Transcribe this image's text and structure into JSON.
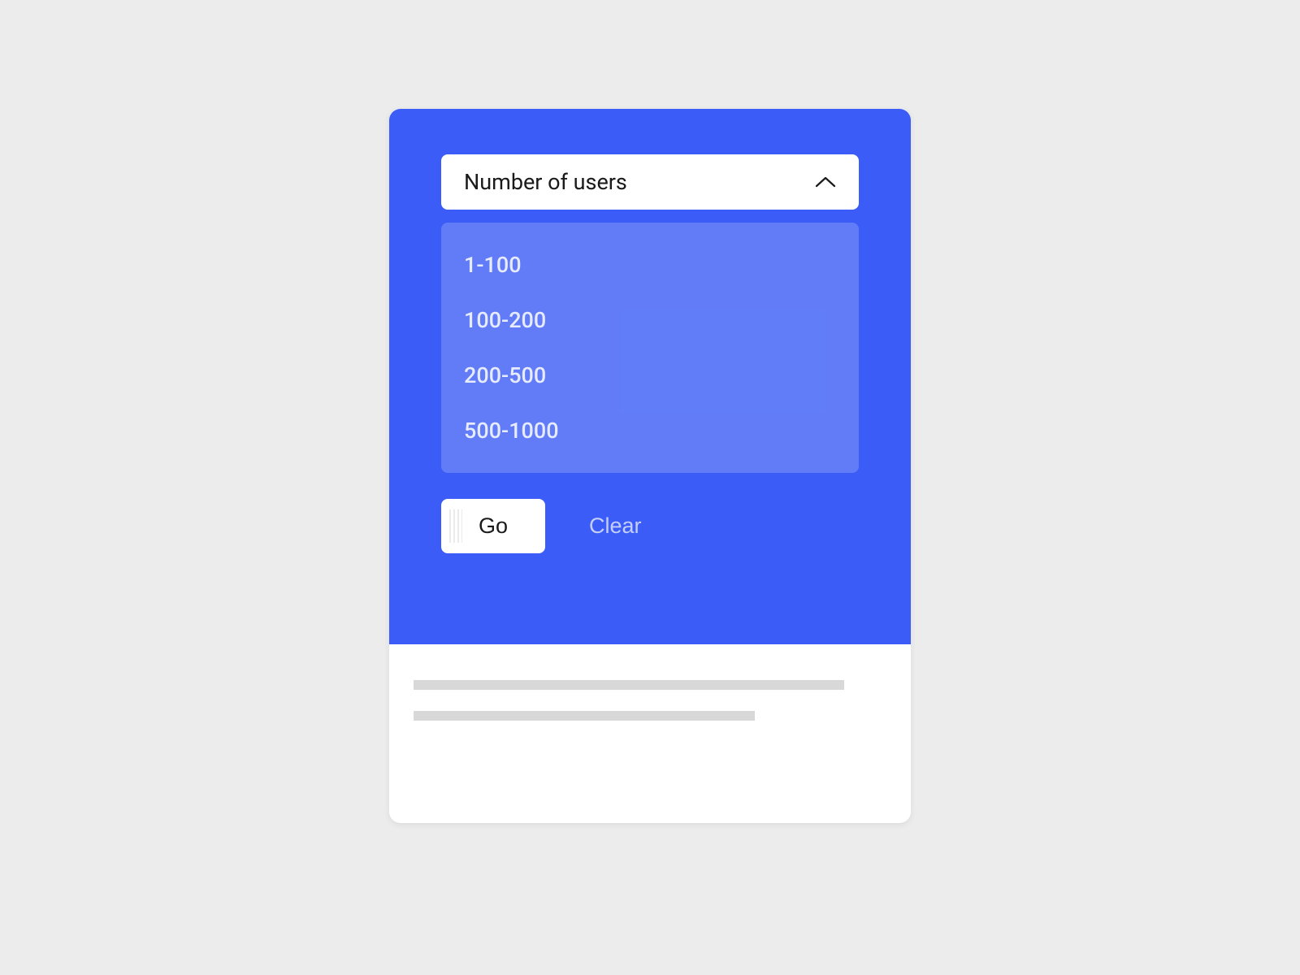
{
  "dropdown": {
    "label": "Number of users",
    "options": [
      "1-100",
      "100-200",
      "200-500",
      "500-1000"
    ]
  },
  "buttons": {
    "go": "Go",
    "clear": "Clear"
  },
  "colors": {
    "primary": "#3B5CF6",
    "background": "#ececec"
  }
}
